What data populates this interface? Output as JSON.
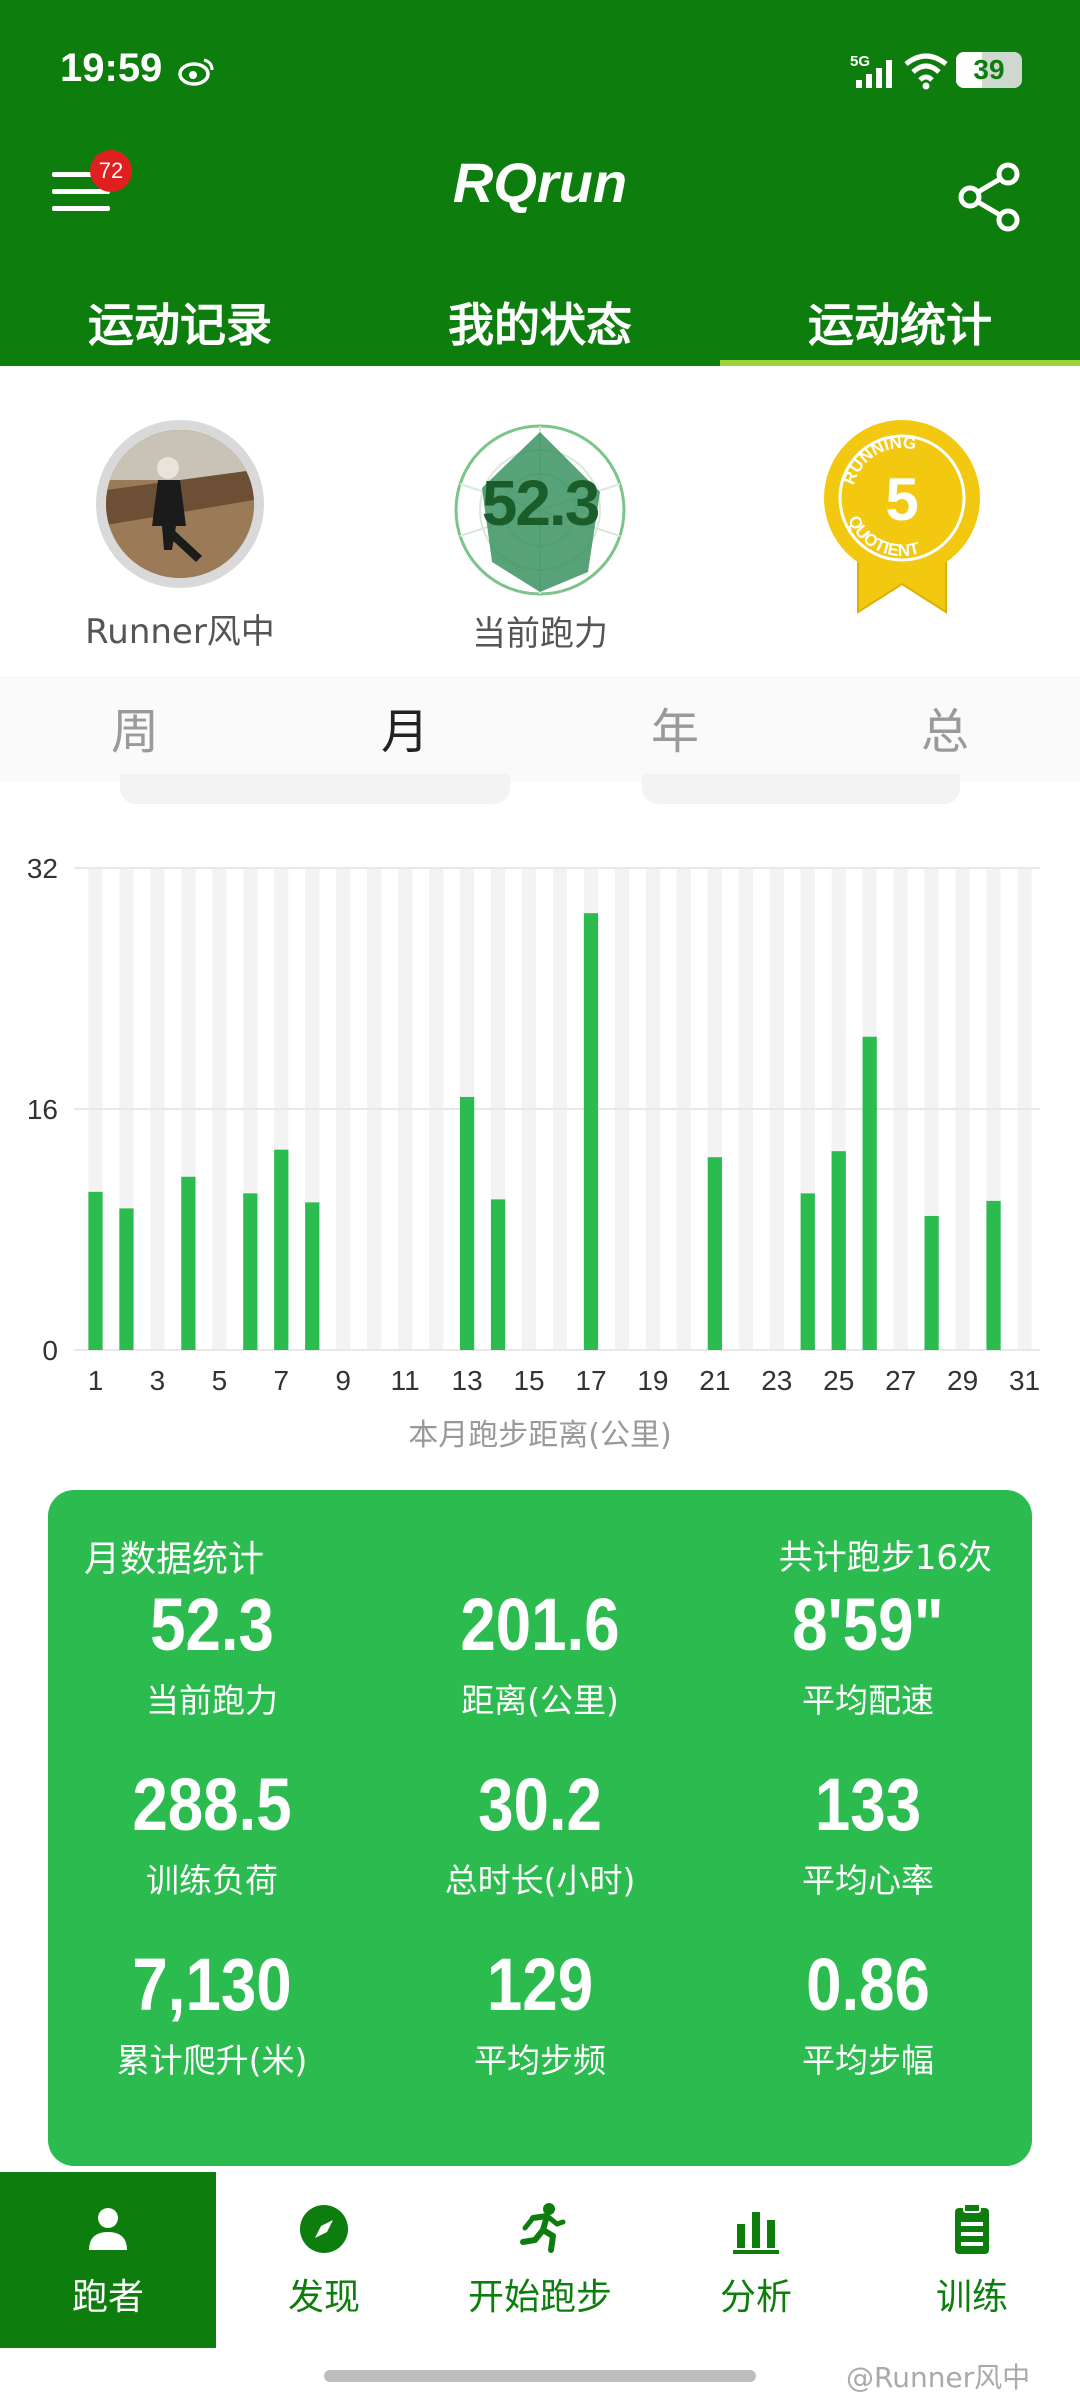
{
  "status_bar": {
    "time": "19:59",
    "network": "5G",
    "battery": "39",
    "battery_level": 0.39
  },
  "header": {
    "title": "RQrun",
    "notification_count": "72"
  },
  "top_tabs": [
    {
      "label": "运动记录",
      "active": false
    },
    {
      "label": "我的状态",
      "active": false
    },
    {
      "label": "运动统计",
      "active": true
    }
  ],
  "profile": {
    "name": "Runner风中",
    "running_power": "52.3",
    "running_power_label": "当前跑力",
    "medal_number": "5",
    "medal_text": "RUNNING QUOTIENT"
  },
  "period_tabs": [
    {
      "label": "周",
      "active": false
    },
    {
      "label": "月",
      "active": true
    },
    {
      "label": "年",
      "active": false
    },
    {
      "label": "总",
      "active": false
    }
  ],
  "chart_data": {
    "type": "bar",
    "xlabel": "本月跑步距离(公里)",
    "ylim": [
      0,
      32
    ],
    "y_ticks": [
      "0",
      "16",
      "32"
    ],
    "x_tick_labels": [
      "1",
      "3",
      "5",
      "7",
      "9",
      "11",
      "13",
      "15",
      "17",
      "19",
      "21",
      "23",
      "25",
      "27",
      "29",
      "31"
    ],
    "categories": [
      1,
      2,
      3,
      4,
      5,
      6,
      7,
      8,
      9,
      10,
      11,
      12,
      13,
      14,
      15,
      16,
      17,
      18,
      19,
      20,
      21,
      22,
      23,
      24,
      25,
      26,
      27,
      28,
      29,
      30,
      31
    ],
    "values": [
      10.5,
      9.4,
      0,
      11.5,
      0,
      10.4,
      13.3,
      9.8,
      0,
      0,
      0,
      0,
      16.8,
      10.0,
      0,
      0,
      29.0,
      0,
      0,
      0,
      12.8,
      0,
      0,
      10.4,
      13.2,
      20.8,
      0,
      8.9,
      0,
      9.9,
      0
    ],
    "bar_color": "#2bbb4f",
    "track_color": "#f3f3f3",
    "grid": true
  },
  "stats": {
    "title": "月数据统计",
    "run_count": "共计跑步16次",
    "cells": [
      {
        "value": "52.3",
        "label": "当前跑力"
      },
      {
        "value": "201.6",
        "label": "距离(公里)"
      },
      {
        "value": "8'59\"",
        "label": "平均配速"
      },
      {
        "value": "288.5",
        "label": "训练负荷"
      },
      {
        "value": "30.2",
        "label": "总时长(小时)"
      },
      {
        "value": "133",
        "label": "平均心率"
      },
      {
        "value": "7,130",
        "label": "累计爬升(米)"
      },
      {
        "value": "129",
        "label": "平均步频"
      },
      {
        "value": "0.86",
        "label": "平均步幅"
      }
    ]
  },
  "bottom_nav": [
    {
      "label": "跑者",
      "icon": "person-icon",
      "active": true
    },
    {
      "label": "发现",
      "icon": "compass-icon",
      "active": false
    },
    {
      "label": "开始跑步",
      "icon": "runner-icon",
      "active": false
    },
    {
      "label": "分析",
      "icon": "bar-chart-icon",
      "active": false
    },
    {
      "label": "训练",
      "icon": "clipboard-icon",
      "active": false
    }
  ],
  "watermark": "@Runner风中",
  "colors": {
    "primary": "#0d7d0d",
    "accent": "#2bbb4f",
    "tab_indicator": "#9bd43a",
    "badge": "#e02020",
    "medal": "#f2c811"
  }
}
